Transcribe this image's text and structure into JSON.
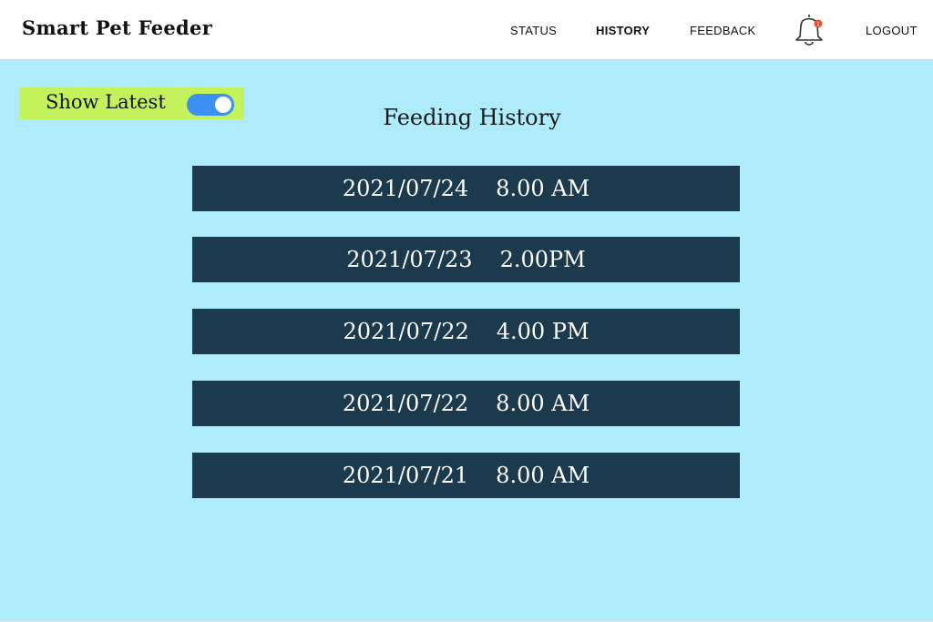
{
  "header": {
    "brand": "Smart Pet Feeder",
    "nav": {
      "status": "STATUS",
      "history": "HISTORY",
      "feedback": "FEEDBACK",
      "logout": "LOGOUT"
    },
    "notifications": {
      "icon": "bell-icon",
      "badge_color": "#e8502a"
    }
  },
  "toggle": {
    "label": "Show Latest",
    "on": true,
    "color": "#3d8ff0"
  },
  "page_title": "Feeding History",
  "history": [
    {
      "date": "2021/07/24",
      "time": "8.00 AM"
    },
    {
      "date": "2021/07/23",
      "time": "2.00PM"
    },
    {
      "date": "2021/07/22",
      "time": "4.00 PM"
    },
    {
      "date": "2021/07/22",
      "time": "8.00 AM"
    },
    {
      "date": "2021/07/21",
      "time": "8.00 AM"
    }
  ],
  "colors": {
    "background": "#aeecfb",
    "row": "#1b3a4e",
    "toggle_box": "#c4f25a"
  }
}
